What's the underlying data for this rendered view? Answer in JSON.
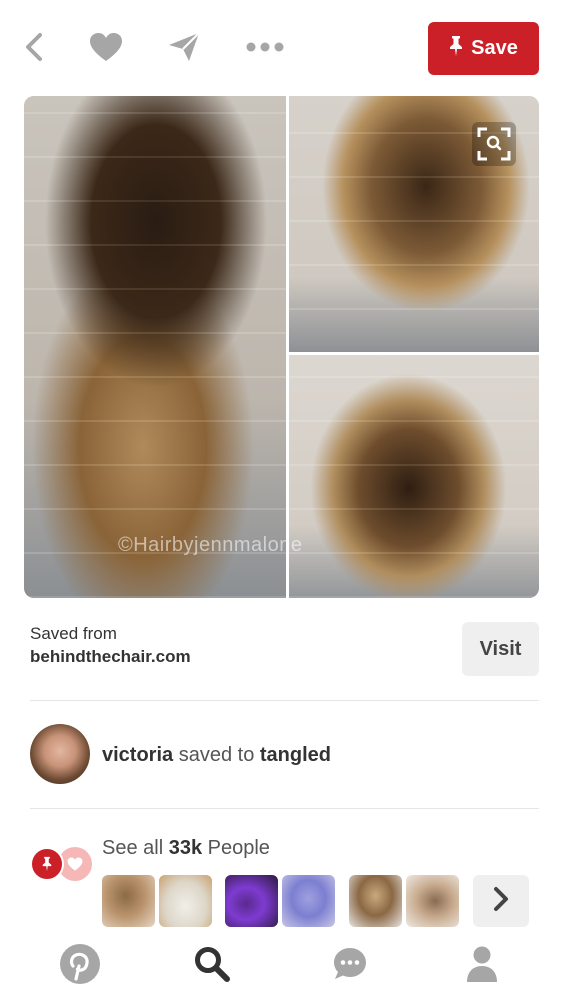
{
  "toolbar": {
    "save_label": "Save",
    "icons": [
      "back-icon",
      "heart-icon",
      "send-icon",
      "more-icon",
      "pin-icon"
    ]
  },
  "image": {
    "watermark": "©Hairbyjennmalone"
  },
  "source": {
    "label": "Saved from",
    "domain": "behindthechair.com",
    "visit_label": "Visit"
  },
  "activity": {
    "user": "victoria",
    "verb": " saved to ",
    "board": "tangled"
  },
  "people": {
    "prefix": "See all ",
    "count": "33k",
    "suffix": " People"
  },
  "colors": {
    "accent": "#cb2027",
    "button_bg": "#efefef",
    "icon_gray": "#a6a6a6"
  }
}
